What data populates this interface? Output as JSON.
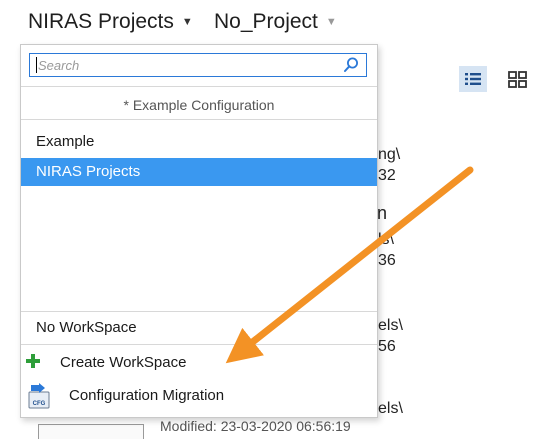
{
  "header": {
    "config_label": "NIRAS Projects",
    "project_label": "No_Project"
  },
  "dropdown": {
    "search": {
      "placeholder": "Search",
      "value": ""
    },
    "config_header": "* Example Configuration",
    "items": [
      {
        "label": "Example",
        "selected": false
      },
      {
        "label": "NIRAS Projects",
        "selected": true
      }
    ],
    "workspace_item": "No WorkSpace",
    "actions": [
      {
        "label": "Create WorkSpace",
        "icon": "plus-icon"
      },
      {
        "label": "Configuration Migration",
        "icon": "cfg-migration-icon",
        "badge": "CFG"
      }
    ]
  },
  "background": {
    "fragments": [
      "ng\\",
      "32",
      "n",
      "ls\\",
      "36",
      "els\\",
      "56",
      "els\\",
      "Modified: 23-03-2020 06:56:19"
    ]
  },
  "colors": {
    "selection": "#3a98f0",
    "search_border": "#2b79d8",
    "plus": "#2e9e3a",
    "arrow": "#f39225",
    "view_toggle_active": "#d6e4f3",
    "icon_blue": "#1f4e8c"
  },
  "icons": [
    "chevron-down-icon",
    "search-icon",
    "list-view-icon",
    "grid-view-icon",
    "plus-icon",
    "cfg-migration-icon"
  ]
}
